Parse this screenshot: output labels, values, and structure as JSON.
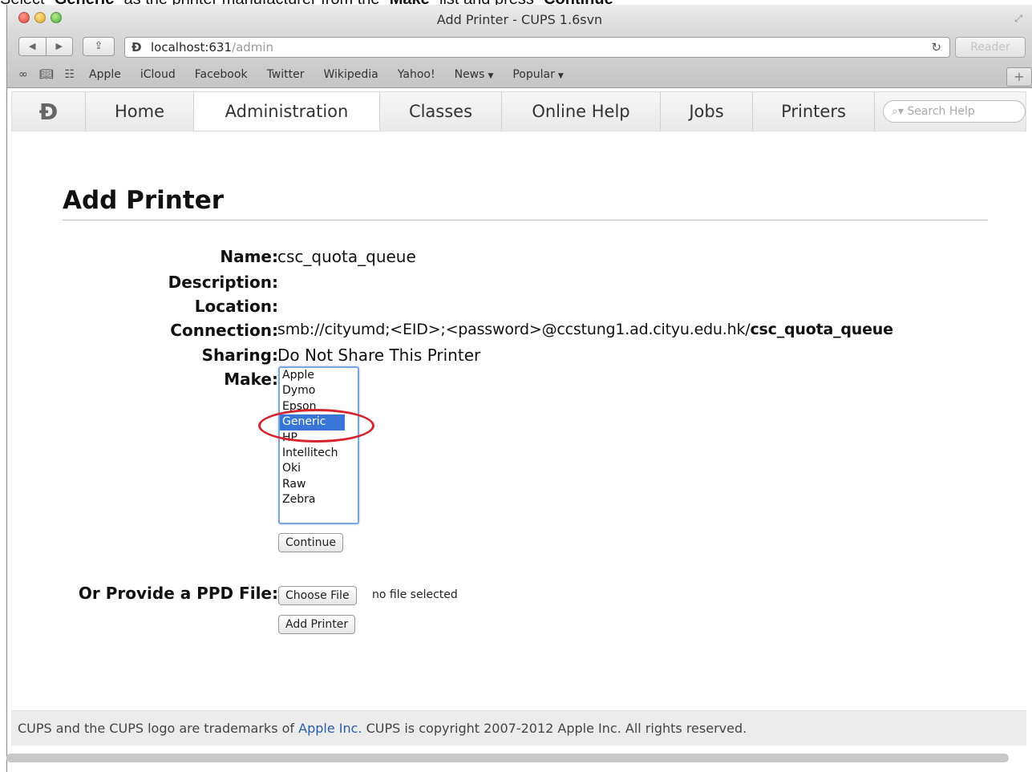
{
  "caption": {
    "pre": "Select “",
    "bold1": "Generic",
    "mid": "” as the printer manufacturer from the “",
    "bold2": "Make",
    "mid2": "” list and press “",
    "bold3": "Continue",
    "post": "”"
  },
  "window": {
    "title": "Add Printer - CUPS 1.6svn"
  },
  "toolbar": {
    "back_icon": "◀",
    "forward_icon": "▶",
    "share_icon": "⇪",
    "url_host": "localhost:631",
    "url_path": "/admin",
    "reader_label": "Reader"
  },
  "bookmarks": {
    "items": [
      "Apple",
      "iCloud",
      "Facebook",
      "Twitter",
      "Wikipedia",
      "Yahoo!",
      "News",
      "Popular"
    ]
  },
  "nav": {
    "tabs": [
      "Home",
      "Administration",
      "Classes",
      "Online Help",
      "Jobs",
      "Printers"
    ],
    "active": "Administration",
    "search_placeholder": "Search Help"
  },
  "form": {
    "title": "Add Printer",
    "name_label": "Name:",
    "name_value": "csc_quota_queue",
    "description_label": "Description:",
    "description_value": "",
    "location_label": "Location:",
    "location_value": "",
    "connection_label": "Connection:",
    "connection_value": "smb://cityumd;<EID>;<password>@ccstung1.ad.cityu.edu.hk/",
    "connection_value_tail": "csc_quota_queue",
    "sharing_label": "Sharing:",
    "sharing_value": "Do Not Share This Printer",
    "make_label": "Make:",
    "make_options": [
      "Apple",
      "Dymo",
      "Epson",
      "Generic",
      "HP",
      "Intellitech",
      "Oki",
      "Raw",
      "Zebra"
    ],
    "make_selected": "Generic",
    "continue_label": "Continue",
    "ppd_label": "Or Provide a PPD File:",
    "choose_file_label": "Choose File",
    "no_file_text": "no file selected",
    "add_printer_label": "Add Printer"
  },
  "footer": {
    "pre": "CUPS and the CUPS logo are trademarks of ",
    "link": "Apple Inc.",
    "post": " CUPS is copyright 2007-2012 Apple Inc. All rights reserved."
  },
  "colors": {
    "selection": "#3776d6",
    "annotation_ring": "#d6242c",
    "link": "#2a5db0"
  }
}
